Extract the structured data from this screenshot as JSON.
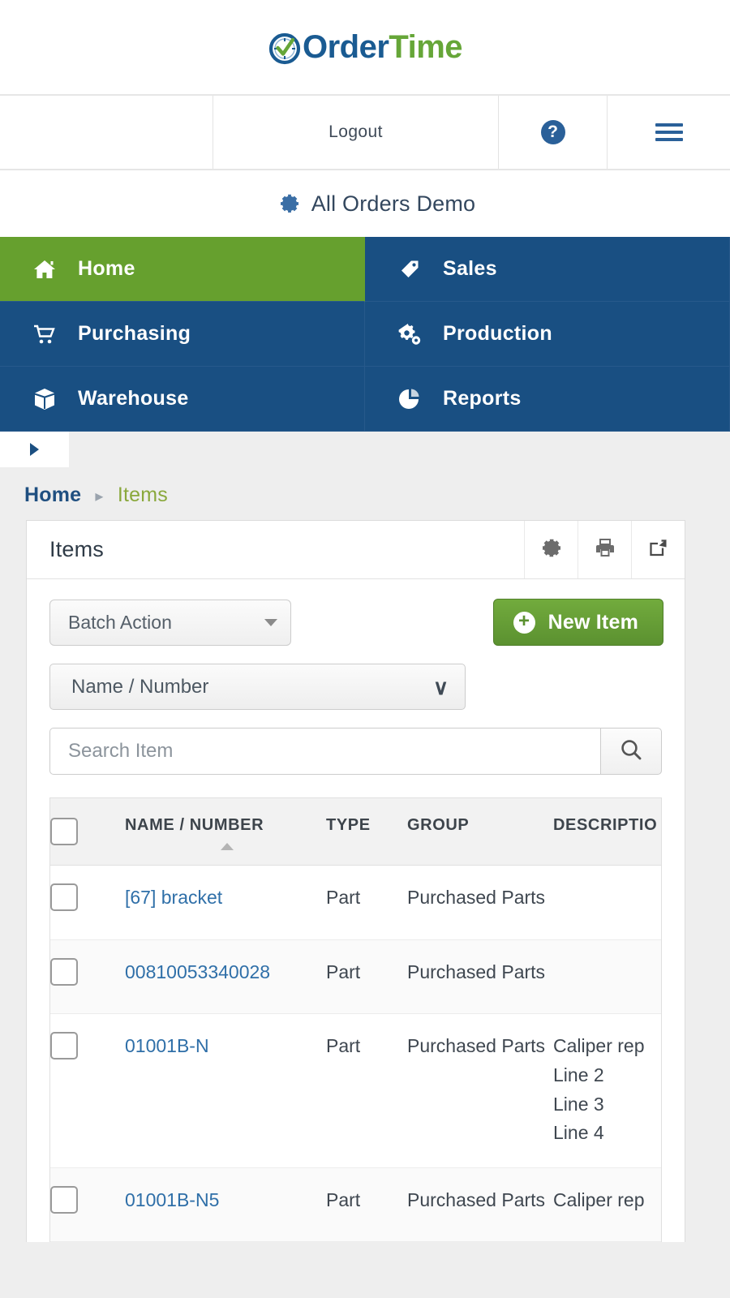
{
  "brand": {
    "logo_order": "Order",
    "logo_time": "Time",
    "accent_green": "#66a638",
    "accent_blue": "#1a5b92",
    "nav_blue": "#194f82",
    "nav_active_green": "#66a02e"
  },
  "header": {
    "logout_label": "Logout",
    "help_icon": "help-circle-icon",
    "help_glyph": "?",
    "menu_icon": "hamburger-menu-icon"
  },
  "company": {
    "gear_icon": "gear-icon",
    "name": "All Orders Demo"
  },
  "nav": {
    "tiles": [
      {
        "label": "Home",
        "icon": "home-icon",
        "active": true
      },
      {
        "label": "Sales",
        "icon": "tag-icon",
        "active": false
      },
      {
        "label": "Purchasing",
        "icon": "shopping-cart-icon",
        "active": false
      },
      {
        "label": "Production",
        "icon": "gears-icon",
        "active": false
      },
      {
        "label": "Warehouse",
        "icon": "box-icon",
        "active": false
      },
      {
        "label": "Reports",
        "icon": "pie-chart-icon",
        "active": false
      }
    ]
  },
  "expander": {
    "icon": "triangle-right-icon"
  },
  "breadcrumb": {
    "home": "Home",
    "separator": "▸",
    "current": "Items"
  },
  "card": {
    "title": "Items",
    "actions": [
      {
        "name": "settings-icon",
        "label": "gear"
      },
      {
        "name": "print-icon",
        "label": "printer"
      },
      {
        "name": "export-icon",
        "label": "export"
      }
    ]
  },
  "toolbar": {
    "batch_action_label": "Batch Action",
    "new_item_label": "New Item",
    "new_item_plus": "+"
  },
  "filter": {
    "field_label": "Name / Number",
    "chevron": "⌄"
  },
  "search": {
    "placeholder": "Search Item",
    "value": "",
    "search_icon": "magnifier-icon"
  },
  "table": {
    "columns": [
      {
        "key": "check",
        "label": ""
      },
      {
        "key": "name",
        "label": "NAME / NUMBER",
        "sorted": "asc"
      },
      {
        "key": "type",
        "label": "TYPE"
      },
      {
        "key": "group",
        "label": "GROUP"
      },
      {
        "key": "desc",
        "label": "DESCRIPTIO"
      }
    ],
    "rows": [
      {
        "name": "[67] bracket",
        "type": "Part",
        "group": "Purchased Parts",
        "desc": ""
      },
      {
        "name": "00810053340028",
        "type": "Part",
        "group": "Purchased Parts",
        "desc": ""
      },
      {
        "name": "01001B-N",
        "type": "Part",
        "group": "Purchased Parts",
        "desc": "Caliper rep\nLine 2\nLine 3\nLine 4"
      },
      {
        "name": "01001B-N5",
        "type": "Part",
        "group": "Purchased Parts",
        "desc": "Caliper rep"
      }
    ]
  }
}
